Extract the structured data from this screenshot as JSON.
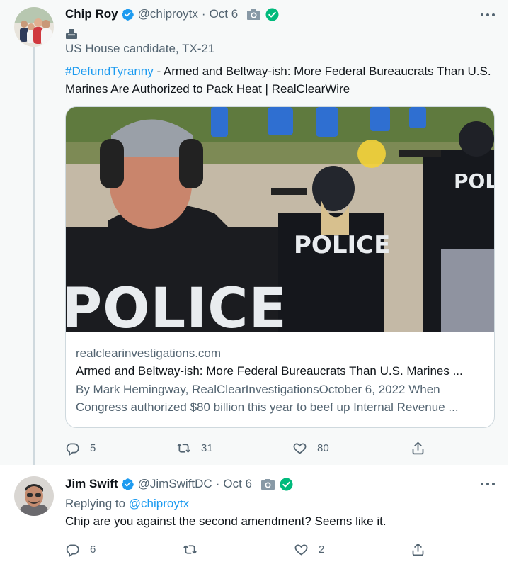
{
  "tweets": [
    {
      "author": {
        "name": "Chip Roy",
        "handle": "@chiproytx"
      },
      "separator": "·",
      "date": "Oct 6",
      "candidate_label": "US House candidate, TX-21",
      "hashtag": "#DefundTyranny",
      "text": " - Armed and Beltway-ish: More Federal Bureaucrats Than U.S. Marines Are Authorized to Pack Heat | RealClearWire",
      "card": {
        "domain": "realclearinvestigations.com",
        "title": "Armed and Beltway-ish: More Federal Bureaucrats Than U.S. Marines ...",
        "description": "By Mark Hemingway, RealClearInvestigationsOctober 6, 2022 When Congress authorized $80 billion this year to beef up Internal Revenue ...",
        "image_badges": [
          "POLICE",
          "POLICE",
          "POLICE"
        ]
      },
      "stats": {
        "replies": "5",
        "retweets": "31",
        "likes": "80"
      },
      "icons": [
        "verified-badge-icon",
        "camera-icon",
        "government-check-icon",
        "ballot-box-icon",
        "more-icon"
      ]
    },
    {
      "author": {
        "name": "Jim Swift",
        "handle": "@JimSwiftDC"
      },
      "separator": "·",
      "date": "Oct 6",
      "replying_label": "Replying to",
      "replying_mention": "@chiproytx",
      "text": "Chip are you against the second amendment? Seems like it.",
      "stats": {
        "replies": "6",
        "retweets": "",
        "likes": "2"
      },
      "icons": [
        "verified-badge-icon",
        "camera-icon",
        "government-check-icon",
        "more-icon"
      ]
    }
  ],
  "colors": {
    "link": "#1d9bf0",
    "verified": "#1d9bf0",
    "government_check": "#00ba7c",
    "secondary_text": "#536471",
    "highlight_background": "#f7f9f9"
  }
}
